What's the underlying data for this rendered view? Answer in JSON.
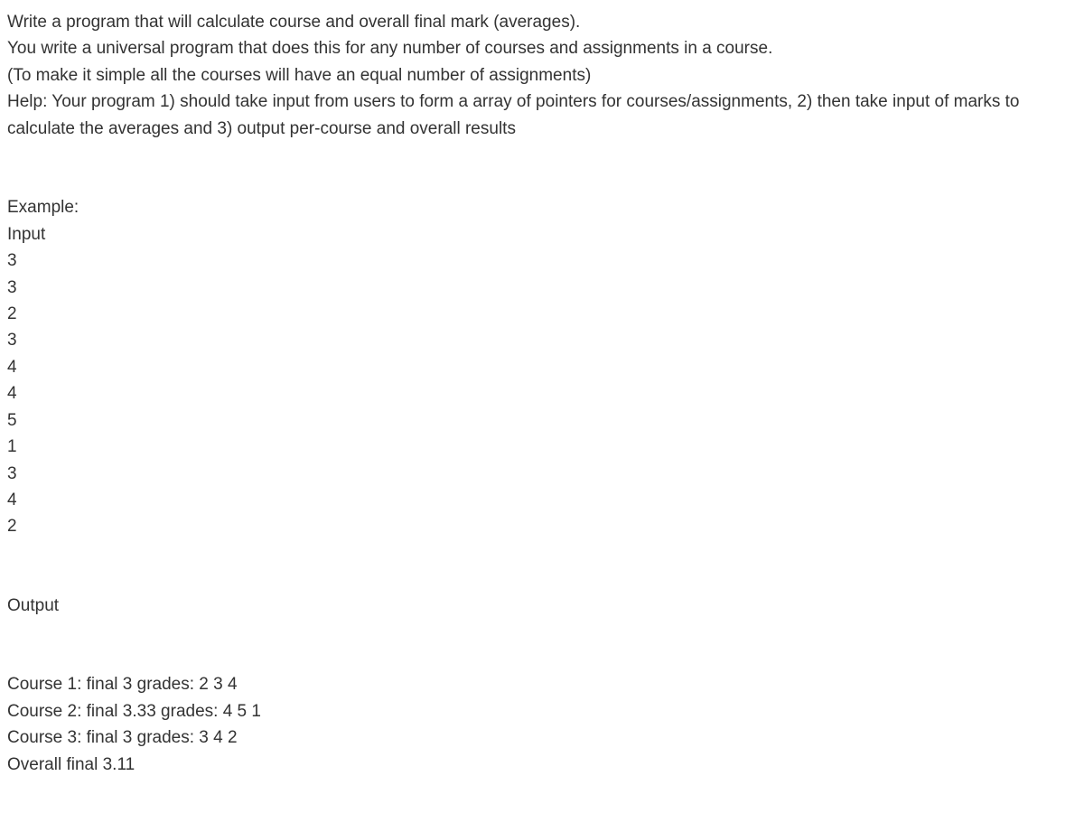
{
  "intro": {
    "p1": "Write a program that will calculate course and overall final mark (averages).",
    "p2": "You write a universal program that does this for any number of courses and assignments in a course.",
    "p3": "(To make it simple all the courses will have an equal number of assignments)",
    "p4": "Help: Your program 1) should take input from users to form a array of pointers for courses/assignments, 2) then take input of marks to calculate the averages and 3) output per-course and overall results"
  },
  "example": {
    "heading": "Example:",
    "input_label": "Input",
    "inputs": [
      "3",
      "3",
      "2",
      "3",
      "4",
      "4",
      "5",
      "1",
      "3",
      "4",
      "2"
    ],
    "output_label": "Output",
    "outputs": [
      "Course 1: final 3 grades: 2 3 4",
      "Course 2: final 3.33 grades: 4 5 1",
      "Course 3: final 3 grades: 3 4 2",
      "Overall final 3.11"
    ]
  }
}
